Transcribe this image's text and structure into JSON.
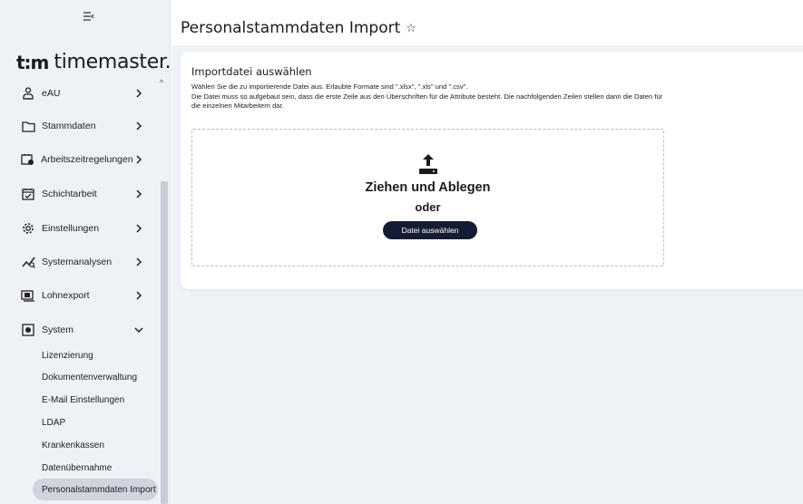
{
  "app": {
    "logo_mark": "t:m",
    "logo_text": "timemaster."
  },
  "sidebar": {
    "items": [
      {
        "label": "eAU",
        "icon": "people-icon"
      },
      {
        "label": "Stammdaten",
        "icon": "folder-icon"
      },
      {
        "label": "Arbeitszeitregelungen",
        "icon": "clock-calendar-icon"
      },
      {
        "label": "Schichtarbeit",
        "icon": "calendar-check-icon"
      },
      {
        "label": "Einstellungen",
        "icon": "gear-icon"
      },
      {
        "label": "Systemanalysen",
        "icon": "analytics-icon"
      },
      {
        "label": "Lohnexport",
        "icon": "export-icon"
      },
      {
        "label": "System",
        "icon": "system-icon"
      }
    ],
    "system_subitems": [
      "Lizenzierung",
      "Dokumentenverwaltung",
      "E-Mail Einstellungen",
      "LDAP",
      "Krankenkassen",
      "Datenübernahme"
    ],
    "active_subitem": "Personalstammdaten Import"
  },
  "header": {
    "title": "Personalstammdaten Import",
    "favorite_symbol": "☆"
  },
  "import_card": {
    "title": "Importdatei auswählen",
    "description_line1": "Wählen Sie die zu importierende Datei aus. Erlaubte Formate sind \".xlsx\", \".xls\" und \".csv\".",
    "description_line2": "Die Datei muss so aufgebaut sein, dass die erste Zeile aus den Überschriften für die Attribute besteht. Die nachfolgenden Zeilen stellen dann die Daten für die einzelnen Mitarbeitern dar.",
    "drop_text": "Ziehen und Ablegen",
    "or_text": "oder",
    "button_label": "Datei auswählen"
  },
  "colors": {
    "sidebar_bg": "#eef1f6",
    "button_bg": "#141c33",
    "active_item_bg": "#cfd5df"
  }
}
